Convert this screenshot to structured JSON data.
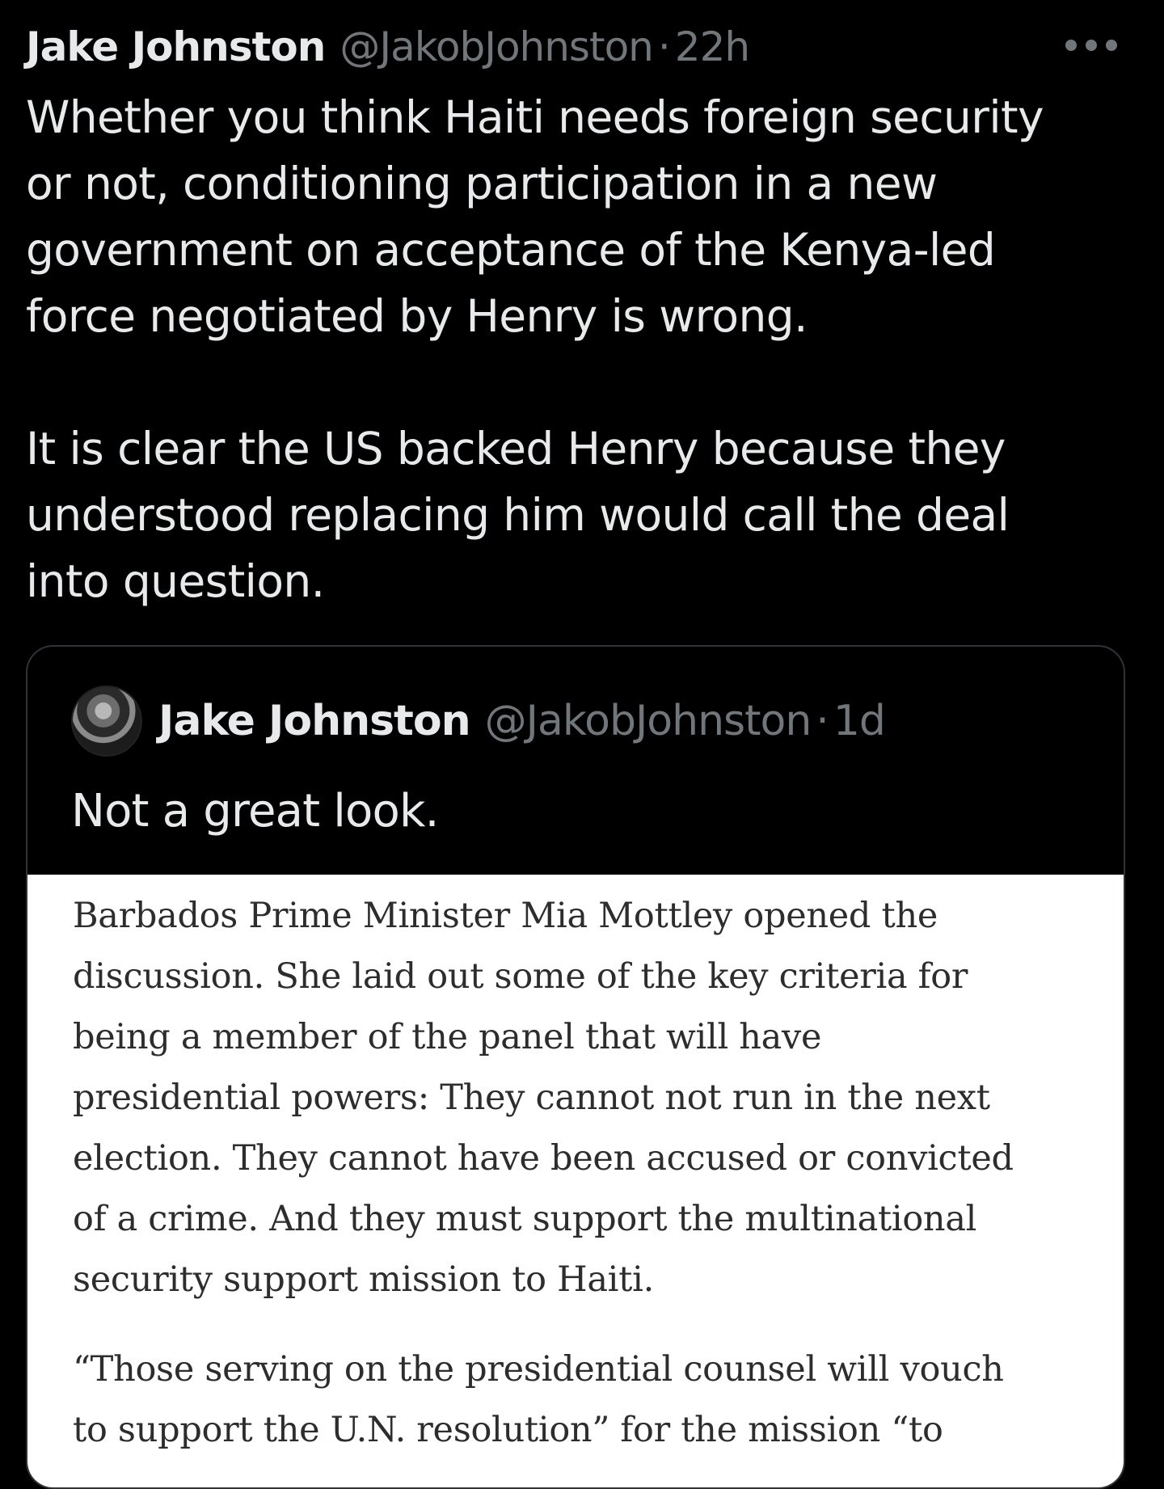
{
  "tweet": {
    "author": {
      "name": "Jake Johnston",
      "handle": "@JakobJohnston",
      "separator": "·",
      "time": "22h"
    },
    "more_icon": "more-horizontal-icon",
    "paragraphs": [
      "Whether you think Haiti needs foreign security\nor not, conditioning participation in a new\ngovernment on acceptance of the Kenya-led\nforce negotiated by Henry is wrong.",
      "It is clear the US backed Henry because they\nunderstood replacing him would call the deal\ninto question."
    ]
  },
  "quote": {
    "author": {
      "name": "Jake Johnston",
      "handle": "@JakobJohnston",
      "separator": "·",
      "time": "1d"
    },
    "text": "Not a great look.",
    "image_text": [
      "Barbados Prime Minister Mia Mottley opened the\ndiscussion. She laid out some of the key criteria for\nbeing a member of the panel that will have\npresidential powers: They cannot not run in the next\nelection. They cannot have been accused or convicted\nof a crime. And they must support the multinational\nsecurity support mission to Haiti.",
      "“Those serving on the presidential counsel will vouch\nto support the U.N. resolution” for the mission “to"
    ]
  }
}
